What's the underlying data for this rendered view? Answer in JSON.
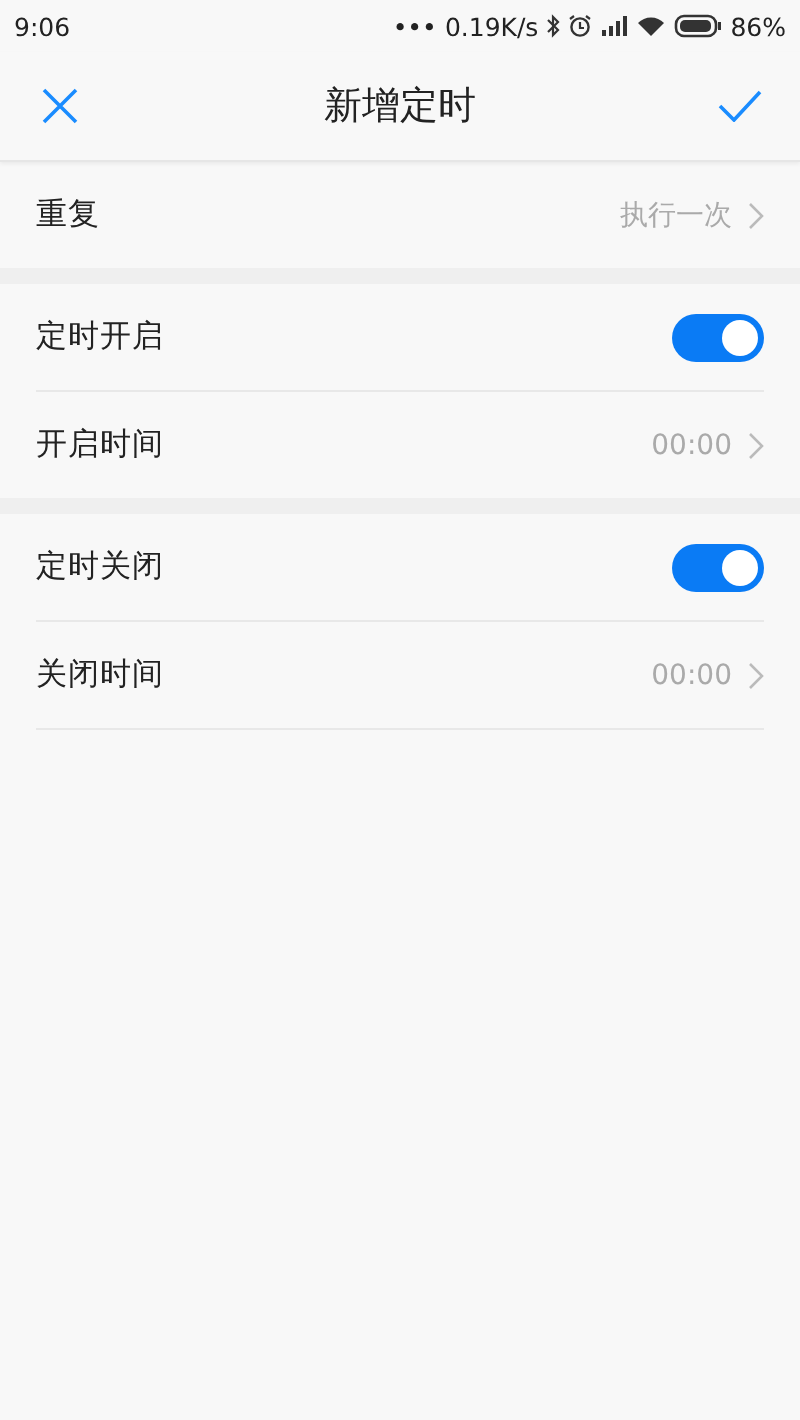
{
  "status_bar": {
    "time": "9:06",
    "dots": "•••",
    "net_speed": "0.19K/s",
    "battery": "86%"
  },
  "header": {
    "title": "新增定时"
  },
  "sections": [
    {
      "rows": [
        {
          "kind": "link",
          "label": "重复",
          "value": "执行一次"
        }
      ]
    },
    {
      "rows": [
        {
          "kind": "toggle",
          "label": "定时开启",
          "on": true
        },
        {
          "kind": "link",
          "label": "开启时间",
          "value": "00:00"
        }
      ]
    },
    {
      "rows": [
        {
          "kind": "toggle",
          "label": "定时关闭",
          "on": true
        },
        {
          "kind": "link",
          "label": "关闭时间",
          "value": "00:00"
        }
      ]
    }
  ]
}
